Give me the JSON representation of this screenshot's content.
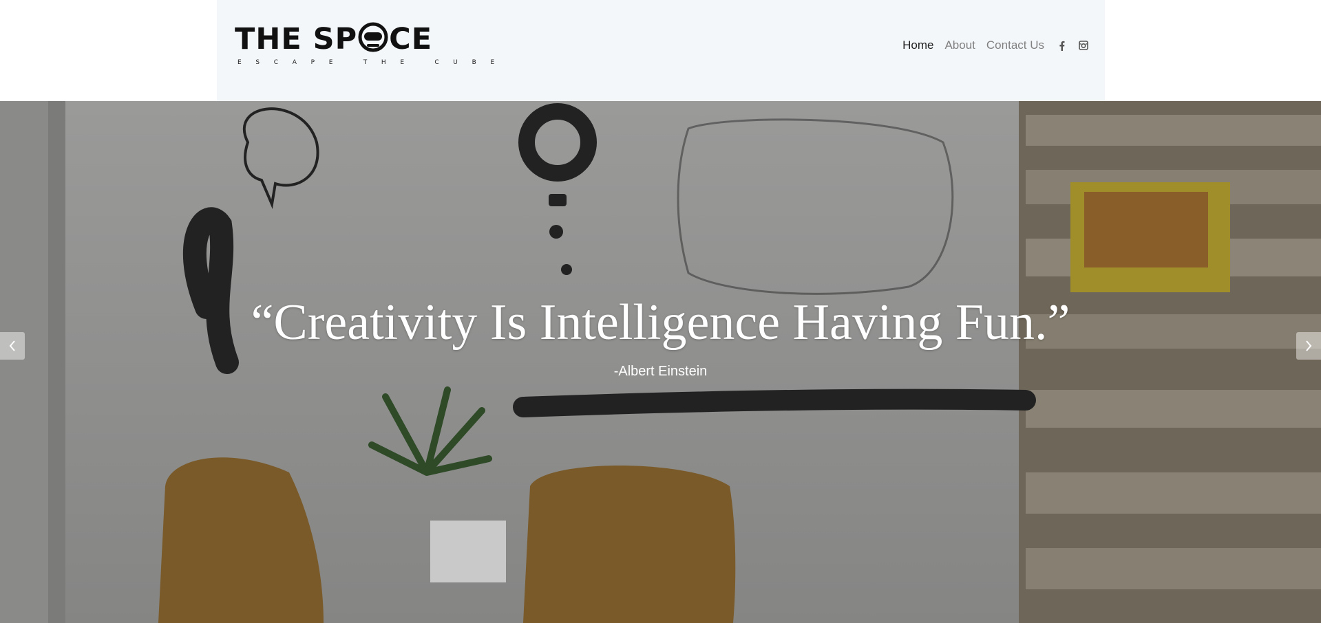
{
  "brand": {
    "name_start": "THE SP",
    "name_end": "CE",
    "tagline": "ESCAPE THE CUBE"
  },
  "nav": {
    "items": [
      {
        "label": "Home",
        "active": true
      },
      {
        "label": "About",
        "active": false
      },
      {
        "label": "Contact Us",
        "active": false
      }
    ],
    "social": [
      "facebook-icon",
      "instagram-icon"
    ]
  },
  "hero": {
    "quote": "“Creativity Is Intelligence Having Fun.”",
    "author": "-Albert Einstein",
    "prev_icon": "chevron-left-icon",
    "next_icon": "chevron-right-icon"
  },
  "colors": {
    "header_bg": "#f4f7fa",
    "nav_active": "#222222",
    "nav_inactive": "#808080",
    "hero_text": "#ffffff"
  }
}
